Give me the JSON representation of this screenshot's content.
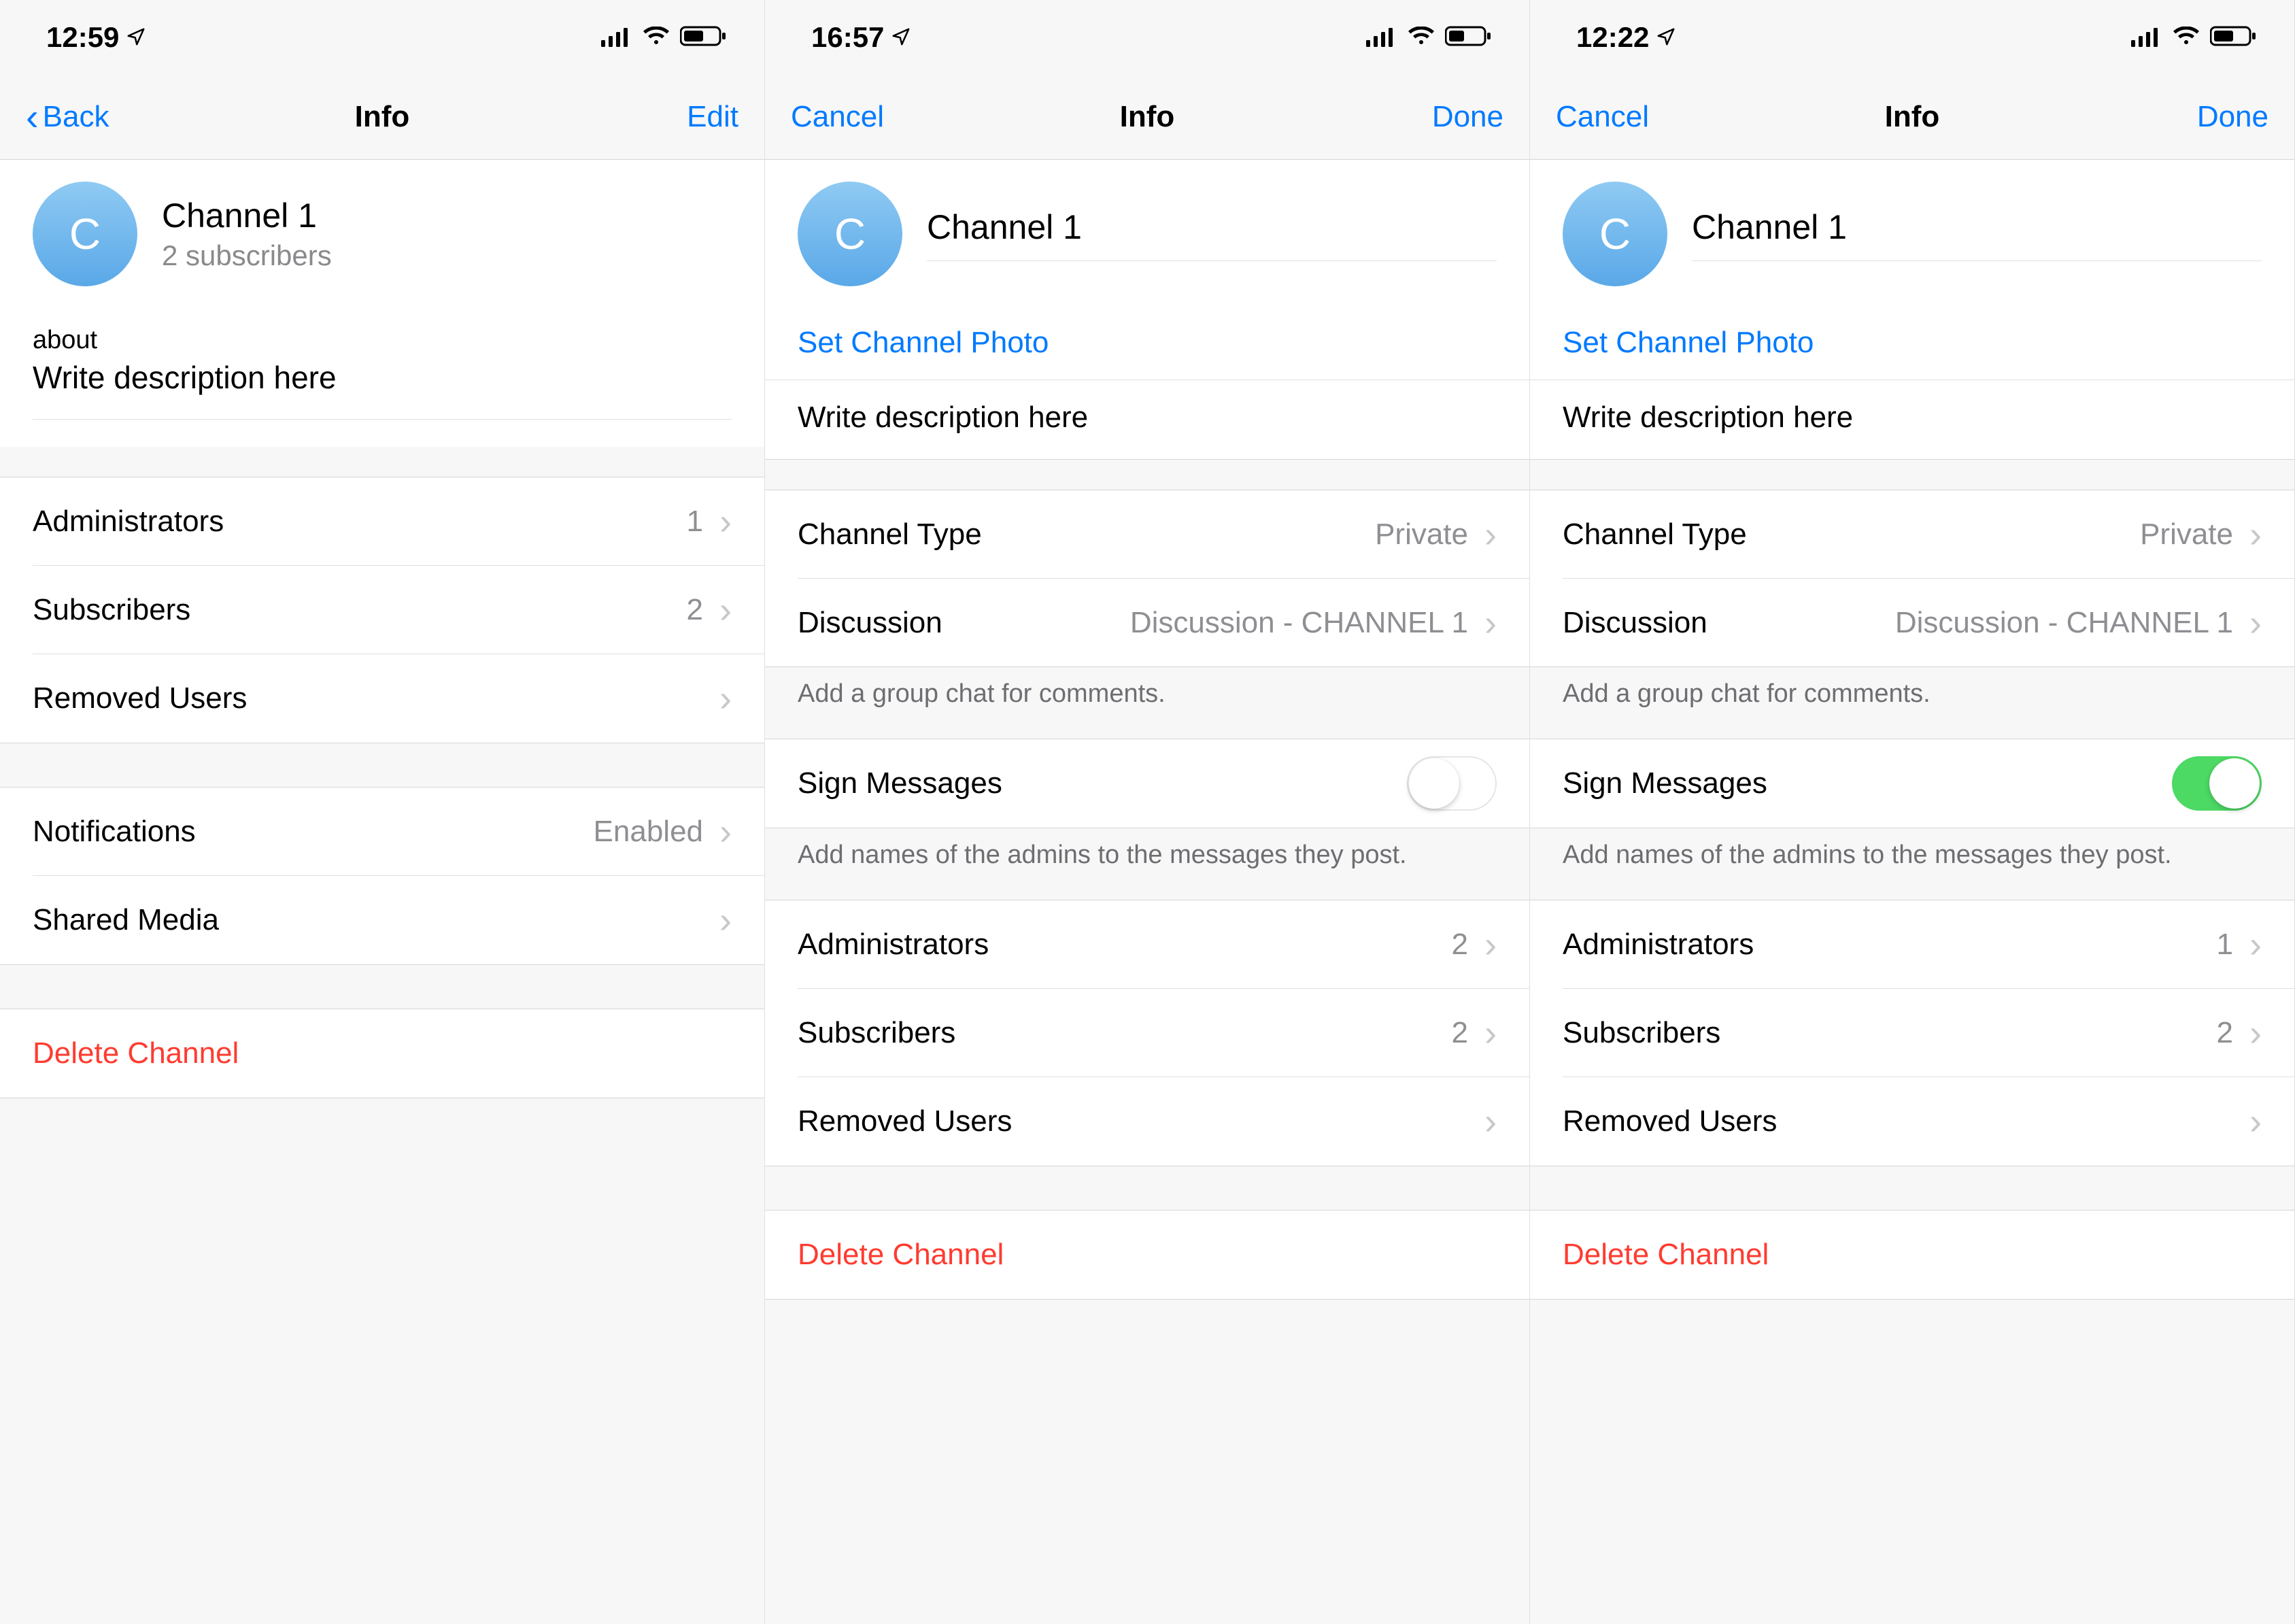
{
  "screens": [
    {
      "status_time": "12:59",
      "nav_left": "Back",
      "nav_title": "Info",
      "nav_right": "Edit",
      "avatar_letter": "C",
      "channel_name": "Channel 1",
      "channel_sub": "2 subscribers",
      "about_label": "about",
      "about_text": "Write description here",
      "rows_members": [
        {
          "label": "Administrators",
          "value": "1"
        },
        {
          "label": "Subscribers",
          "value": "2"
        },
        {
          "label": "Removed Users",
          "value": ""
        }
      ],
      "rows_settings": [
        {
          "label": "Notifications",
          "value": "Enabled"
        },
        {
          "label": "Shared Media",
          "value": ""
        }
      ],
      "delete_label": "Delete Channel"
    },
    {
      "status_time": "16:57",
      "nav_left": "Cancel",
      "nav_title": "Info",
      "nav_right": "Done",
      "avatar_letter": "C",
      "channel_name": "Channel 1",
      "set_photo": "Set Channel Photo",
      "desc_placeholder": "Write description here",
      "type_label": "Channel Type",
      "type_value": "Private",
      "discussion_label": "Discussion",
      "discussion_value": "Discussion - CHANNEL 1",
      "discussion_hint": "Add a group chat for comments.",
      "sign_label": "Sign Messages",
      "sign_on": false,
      "sign_hint": "Add names of the admins to the messages they post.",
      "rows_members": [
        {
          "label": "Administrators",
          "value": "2"
        },
        {
          "label": "Subscribers",
          "value": "2"
        },
        {
          "label": "Removed Users",
          "value": ""
        }
      ],
      "delete_label": "Delete Channel"
    },
    {
      "status_time": "12:22",
      "nav_left": "Cancel",
      "nav_title": "Info",
      "nav_right": "Done",
      "avatar_letter": "C",
      "channel_name": "Channel 1",
      "set_photo": "Set Channel Photo",
      "desc_placeholder": "Write description here",
      "type_label": "Channel Type",
      "type_value": "Private",
      "discussion_label": "Discussion",
      "discussion_value": "Discussion - CHANNEL 1",
      "discussion_hint": "Add a group chat for comments.",
      "sign_label": "Sign Messages",
      "sign_on": true,
      "sign_hint": "Add names of the admins to the messages they post.",
      "rows_members": [
        {
          "label": "Administrators",
          "value": "1"
        },
        {
          "label": "Subscribers",
          "value": "2"
        },
        {
          "label": "Removed Users",
          "value": ""
        }
      ],
      "delete_label": "Delete Channel"
    }
  ]
}
